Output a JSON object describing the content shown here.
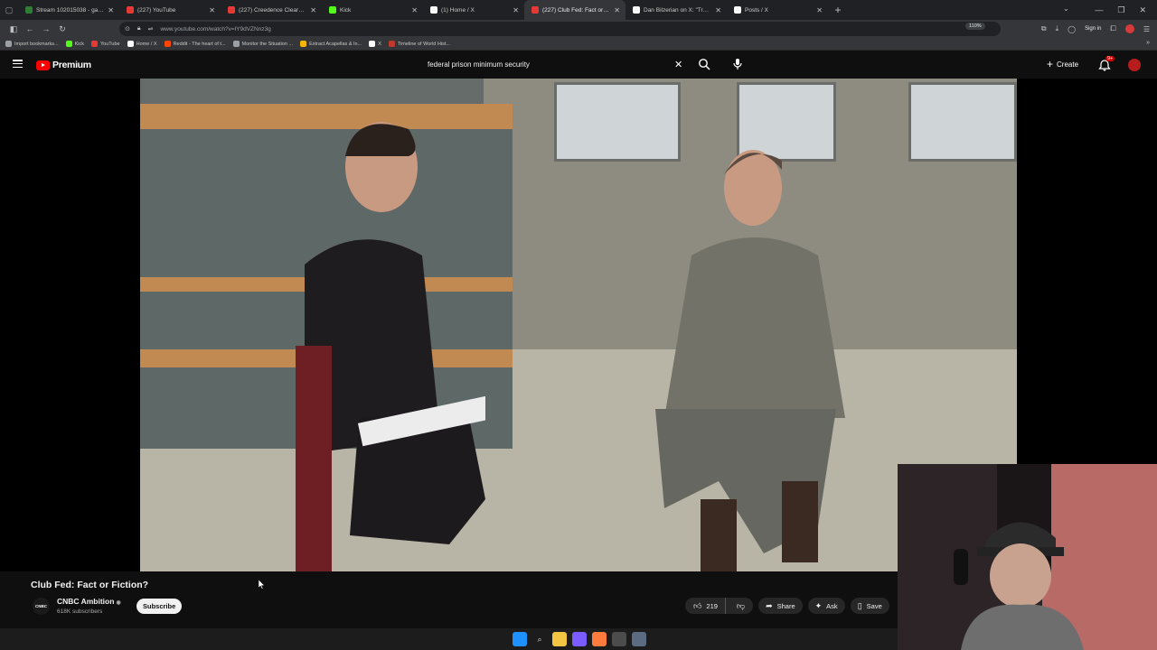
{
  "browser": {
    "tabs": [
      {
        "label": "Stream 102015038 - garydavid",
        "icon_color": "#2e7d32",
        "active": false
      },
      {
        "label": "(227) YouTube",
        "icon_color": "#e53935",
        "active": false
      },
      {
        "label": "(227) Creedence Clearwater Re",
        "icon_color": "#e53935",
        "active": false
      },
      {
        "label": "Kick",
        "icon_color": "#53fc18",
        "active": false
      },
      {
        "label": "(1) Home / X",
        "icon_color": "#ffffff",
        "active": false
      },
      {
        "label": "(227) Club Fed: Fact or Ficti",
        "icon_color": "#e53935",
        "active": true
      },
      {
        "label": "Dan Bilzerian on X: \"Trump: We",
        "icon_color": "#ffffff",
        "active": false
      },
      {
        "label": "Posts / X",
        "icon_color": "#ffffff",
        "active": false
      }
    ],
    "new_tab_symbol": "+",
    "url": "www.youtube.com/watch?v=lY9dVZNnz3g",
    "zoom": "110%",
    "signin_label": "Sign in",
    "bookmarks": [
      {
        "label": "Import bookmarks...",
        "icon_color": "#9aa0a6"
      },
      {
        "label": "Kick",
        "icon_color": "#53fc18"
      },
      {
        "label": "YouTube",
        "icon_color": "#e53935"
      },
      {
        "label": "Home / X",
        "icon_color": "#ffffff"
      },
      {
        "label": "Reddit - The heart of t...",
        "icon_color": "#ff4500"
      },
      {
        "label": "Monitor the Situation ...",
        "icon_color": "#9aa0a6"
      },
      {
        "label": "Extract Acapellas & In...",
        "icon_color": "#f4b400"
      },
      {
        "label": "X",
        "icon_color": "#ffffff"
      },
      {
        "label": "Timeline of World Hist...",
        "icon_color": "#c0392b"
      }
    ]
  },
  "youtube": {
    "logo_text": "Premium",
    "search_query": "federal prison minimum security",
    "create_label": "Create",
    "notification_count": "9+",
    "brand_color": "#ff0000"
  },
  "video": {
    "title": "Club Fed: Fact or Fiction?",
    "channel_name": "CNBC Ambition",
    "channel_avatar_text": "CNBC",
    "subscribers": "618K subscribers",
    "subscribe_label": "Subscribe",
    "likes": "219",
    "share_label": "Share",
    "ask_label": "Ask",
    "save_label": "Save"
  },
  "icons": {
    "search": "search-icon",
    "mic": "mic-icon",
    "bell": "bell-icon",
    "like": "thumbs-up-icon",
    "dislike": "thumbs-down-icon",
    "share": "share-icon",
    "ask": "sparkle-icon",
    "save": "bookmark-icon"
  }
}
